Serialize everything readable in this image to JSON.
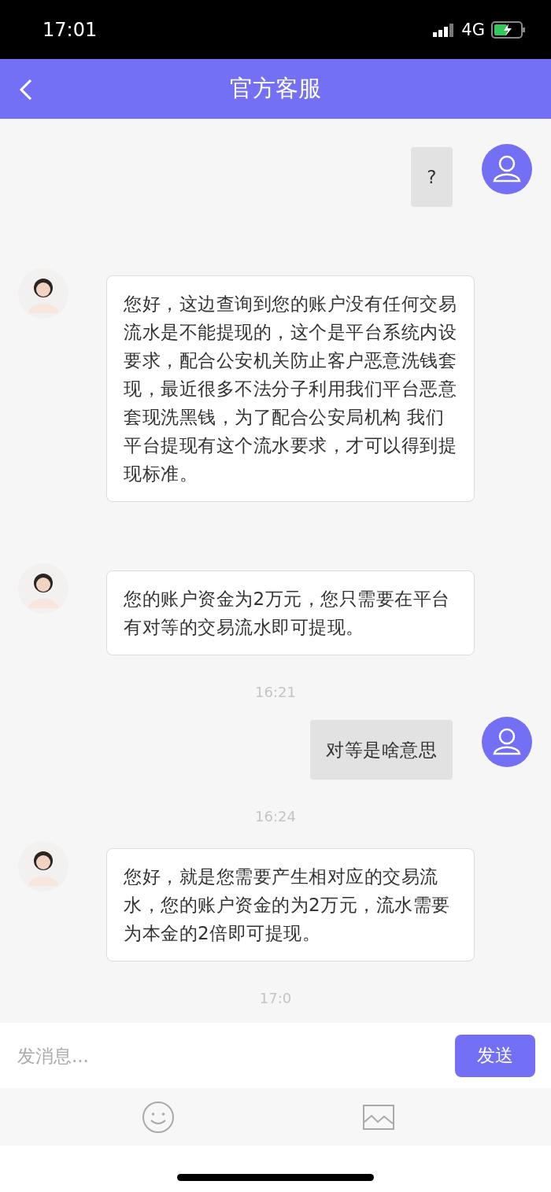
{
  "status_bar": {
    "time": "17:01",
    "network": "4G"
  },
  "header": {
    "title": "官方客服"
  },
  "messages": [
    {
      "kind": "outgoing",
      "text": "?"
    },
    {
      "kind": "incoming",
      "text": "您好，这边查询到您的账户没有任何交易流水是不能提现的，这个是平台系统内设要求，配合公安机关防止客户恶意洗钱套现，最近很多不法分子利用我们平台恶意套现洗黑钱，为了配合公安局机构 我们平台提现有这个流水要求，才可以得到提现标准。"
    },
    {
      "kind": "incoming",
      "text": "您的账户资金为2万元，您只需要在平台有对等的交易流水即可提现。"
    },
    {
      "kind": "timestamp",
      "text": "16:21"
    },
    {
      "kind": "outgoing",
      "text": "对等是啥意思"
    },
    {
      "kind": "timestamp",
      "text": "16:24"
    },
    {
      "kind": "incoming",
      "text": "您好，就是您需要产生相对应的交易流水，您的账户资金的为2万元，流水需要为本金的2倍即可提现。"
    },
    {
      "kind": "timestamp",
      "text": "17:0"
    }
  ],
  "composer": {
    "placeholder": "发消息...",
    "send": "发送"
  }
}
